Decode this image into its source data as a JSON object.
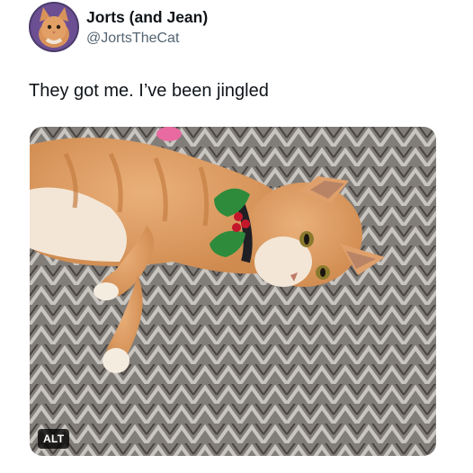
{
  "author": {
    "display_name": "Jorts (and Jean)",
    "handle": "@JortsTheCat",
    "avatar_icon": "orange-cat-avatar"
  },
  "tweet": {
    "text": "They got me. I’ve been jingled"
  },
  "media": {
    "alt_label": "ALT",
    "subject": "orange tabby cat lying on herringbone carpet wearing holly collar",
    "colors": {
      "fur": "#e3a066",
      "carpet": "#8a8581",
      "holly_leaf": "#2e8b3c",
      "berry": "#c4172b"
    }
  }
}
